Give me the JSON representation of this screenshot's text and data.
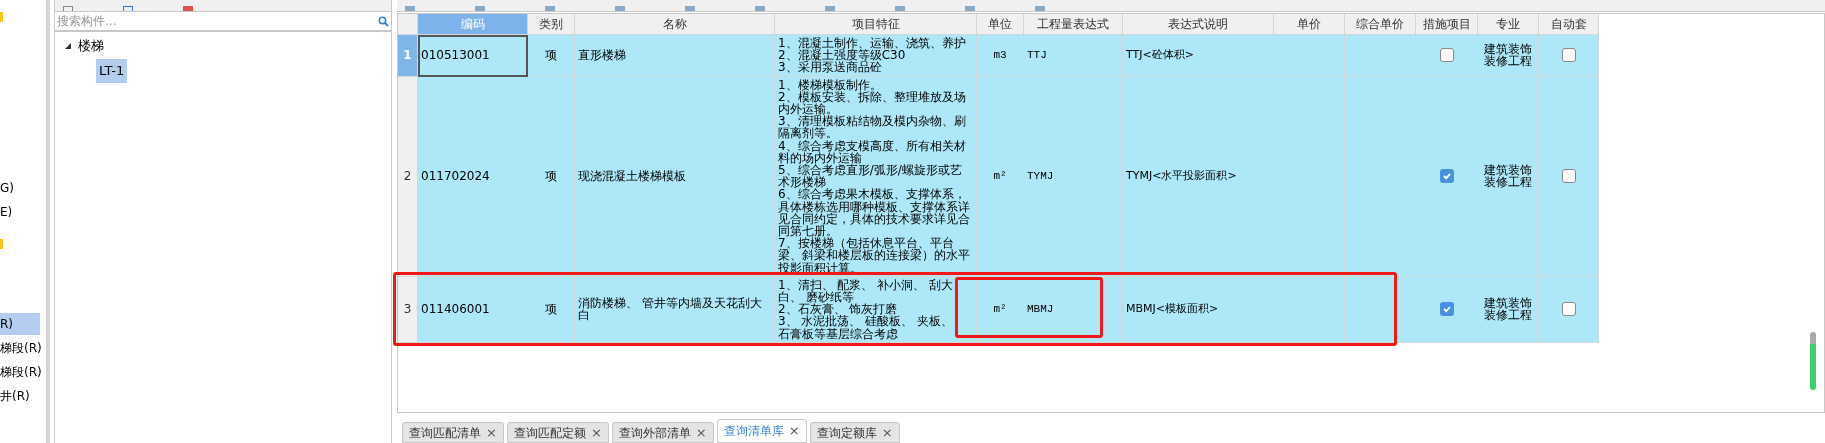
{
  "side_list": {
    "items": [
      {
        "label": "G)",
        "selected": false
      },
      {
        "label": "E)",
        "selected": false
      },
      {
        "label": "R)",
        "selected": true
      },
      {
        "label": "梯段(R)",
        "selected": false
      },
      {
        "label": "梯段(R)",
        "selected": false
      },
      {
        "label": "井(R)",
        "selected": false
      }
    ]
  },
  "component_panel": {
    "search": {
      "placeholder": "搜索构件..."
    },
    "tree": [
      {
        "label": "楼梯",
        "expanded": true,
        "selected": false,
        "children": [
          {
            "label": "LT-1",
            "selected": true
          }
        ]
      }
    ]
  },
  "table": {
    "columns": [
      {
        "label": "编码",
        "selected": true
      },
      {
        "label": "类别",
        "selected": false
      },
      {
        "label": "名称",
        "selected": false
      },
      {
        "label": "项目特征",
        "selected": false
      },
      {
        "label": "单位",
        "selected": false
      },
      {
        "label": "工程量表达式",
        "selected": false
      },
      {
        "label": "表达式说明",
        "selected": false
      },
      {
        "label": "单价",
        "selected": false
      },
      {
        "label": "综合单价",
        "selected": false
      },
      {
        "label": "措施项目",
        "selected": false
      },
      {
        "label": "专业",
        "selected": false
      },
      {
        "label": "自动套",
        "selected": false
      }
    ],
    "rows": [
      {
        "number": "1",
        "selected": true,
        "code": "010513001",
        "category": "项",
        "name": "直形楼梯",
        "features": [
          "1、混凝土制作、运输、浇筑、养护",
          "2、混凝土强度等级C30",
          "3、采用泵送商品砼"
        ],
        "unit": "m3",
        "expression": "TTJ",
        "expression_note": "TTJ<砼体积>",
        "measure_item": false,
        "discipline": "建筑装饰装修工程",
        "auto_apply": false
      },
      {
        "number": "2",
        "selected": false,
        "code": "011702024",
        "category": "项",
        "name": "现浇混凝土楼梯模板",
        "features": [
          "1、楼梯模板制作。",
          "2、模板安装、拆除、整理堆放及场",
          "内外运输。",
          "3、清理模板粘结物及模内杂物、刷",
          "隔离剂等。",
          "4、综合考虑支模高度、所有相关材",
          "料的场内外运输",
          "5、综合考虑直形/弧形/螺旋形或艺",
          "术形楼梯",
          "6、综合考虑果木模板、支撑体系，",
          "具体楼栋选用哪种模板、支撑体系详",
          "见合同约定，具体的技术要求详见合",
          "同第七册。",
          "7、按楼梯（包括休息平台、平台",
          "梁、斜梁和楼层板的连接梁）的水平",
          "投影面积计算。"
        ],
        "unit": "m²",
        "expression": "TYMJ",
        "expression_note": "TYMJ<水平投影面积>",
        "measure_item": true,
        "discipline": "建筑装饰装修工程",
        "auto_apply": false
      },
      {
        "number": "3",
        "selected": false,
        "code": "011406001",
        "category": "项",
        "name": "消防楼梯、 管井等内墙及天花刮大白",
        "features": [
          "1、清扫、 配浆、 补小洞、 刮大",
          "白、 磨砂纸等",
          "2、石灰膏、 饰灰打磨",
          "3、 水泥批荡、 硅酸板、 夹板、",
          "石膏板等基层综合考虑"
        ],
        "unit": "m²",
        "expression": "MBMJ",
        "expression_note": "MBMJ<模板面积>",
        "measure_item": true,
        "discipline": "建筑装饰装修工程",
        "auto_apply": false
      }
    ]
  },
  "bottom_tabs": [
    {
      "label": "查询匹配清单",
      "close": "×",
      "selected": false
    },
    {
      "label": "查询匹配定额",
      "close": "×",
      "selected": false
    },
    {
      "label": "查询外部清单",
      "close": "×",
      "selected": false
    },
    {
      "label": "查询清单库",
      "close": "×",
      "selected": true
    },
    {
      "label": "查询定额库",
      "close": "×",
      "selected": false
    }
  ]
}
